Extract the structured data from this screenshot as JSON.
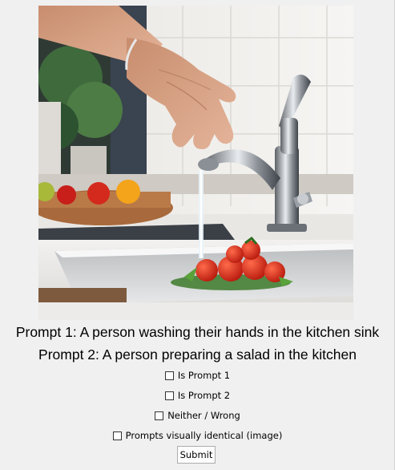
{
  "prompts": {
    "prompt1": "Prompt 1: A person washing their hands in the kitchen sink",
    "prompt2": "Prompt 2: A person preparing a salad in the kitchen"
  },
  "options": {
    "is_prompt_1": "Is Prompt 1",
    "is_prompt_2": "Is Prompt 2",
    "neither": "Neither / Wrong",
    "identical": "Prompts visually identical (image)"
  },
  "submit_label": "Submit"
}
